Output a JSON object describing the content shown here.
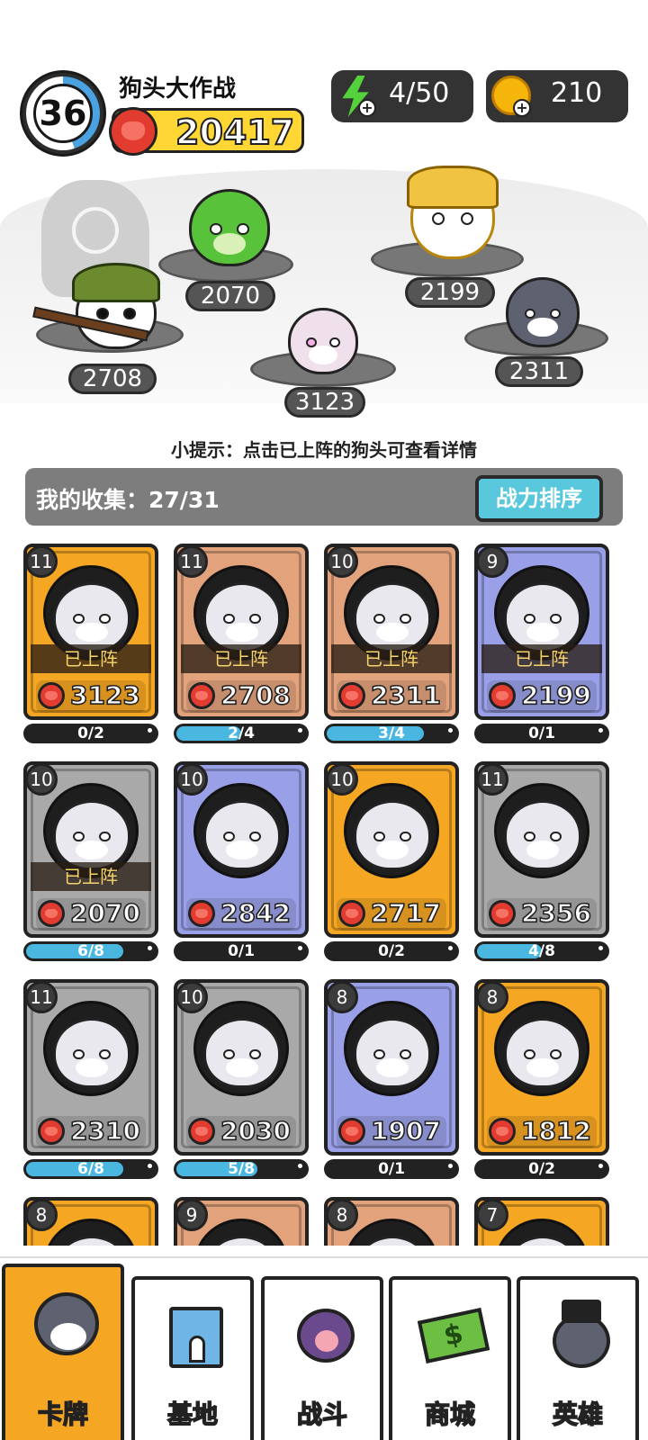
{
  "header": {
    "level": "36",
    "player_name": "狗头大作战",
    "total_power": "20417",
    "energy": "4/50",
    "coins": "210"
  },
  "lineup": [
    {
      "name": "salad-dog",
      "power": "2070"
    },
    {
      "name": "armored-dog",
      "power": "2199"
    },
    {
      "name": "soldier-dog",
      "power": "2708"
    },
    {
      "name": "laser-eye-dog",
      "power": "3123"
    },
    {
      "name": "husky",
      "power": "2311"
    }
  ],
  "tip": "小提示：点击已上阵的狗头可查看详情",
  "collection": {
    "label": "我的收集：27/31",
    "sort_button": "战力排序"
  },
  "cards": [
    {
      "level": "11",
      "deployed": "已上阵",
      "power": "3123",
      "progress": "0/2",
      "fill": 0,
      "color": "#f5a623",
      "portrait": "laser-eye-dog"
    },
    {
      "level": "11",
      "deployed": "已上阵",
      "power": "2708",
      "progress": "2/4",
      "fill": 0.5,
      "color": "#e2a27c",
      "portrait": "soldier-dog"
    },
    {
      "level": "10",
      "deployed": "已上阵",
      "power": "2311",
      "progress": "3/4",
      "fill": 0.75,
      "color": "#e2a27c",
      "portrait": "husky"
    },
    {
      "level": "9",
      "deployed": "已上阵",
      "power": "2199",
      "progress": "0/1",
      "fill": 0,
      "color": "#9aa0e8",
      "portrait": "armored-dog"
    },
    {
      "level": "10",
      "deployed": "已上阵",
      "power": "2070",
      "progress": "6/8",
      "fill": 0.75,
      "color": "#a9a9a9",
      "portrait": "salad-dog"
    },
    {
      "level": "10",
      "deployed": "",
      "power": "2842",
      "progress": "0/1",
      "fill": 0,
      "color": "#9aa0e8",
      "portrait": "ninja-dog"
    },
    {
      "level": "10",
      "deployed": "",
      "power": "2717",
      "progress": "0/2",
      "fill": 0,
      "color": "#f5a623",
      "portrait": "masked-dog"
    },
    {
      "level": "11",
      "deployed": "",
      "power": "2356",
      "progress": "4/8",
      "fill": 0.5,
      "color": "#a9a9a9",
      "portrait": "laptop-dog"
    },
    {
      "level": "11",
      "deployed": "",
      "power": "2310",
      "progress": "6/8",
      "fill": 0.75,
      "color": "#a9a9a9",
      "portrait": "grumpy-dog"
    },
    {
      "level": "10",
      "deployed": "",
      "power": "2030",
      "progress": "5/8",
      "fill": 0.625,
      "color": "#a9a9a9",
      "portrait": "eyebrow-dog"
    },
    {
      "level": "8",
      "deployed": "",
      "power": "1907",
      "progress": "0/1",
      "fill": 0,
      "color": "#9aa0e8",
      "portrait": "crown-dog"
    },
    {
      "level": "8",
      "deployed": "",
      "power": "1812",
      "progress": "0/2",
      "fill": 0,
      "color": "#f5a623",
      "portrait": "pikachu-dog"
    },
    {
      "level": "8",
      "deployed": "",
      "power": "",
      "progress": "",
      "fill": 0,
      "color": "#f5a623",
      "portrait": "green-dog"
    },
    {
      "level": "9",
      "deployed": "",
      "power": "",
      "progress": "",
      "fill": 0,
      "color": "#e2a27c",
      "portrait": "gray-dog"
    },
    {
      "level": "8",
      "deployed": "",
      "power": "",
      "progress": "",
      "fill": 0,
      "color": "#e2a27c",
      "portrait": "yellow-dog"
    },
    {
      "level": "7",
      "deployed": "",
      "power": "",
      "progress": "",
      "fill": 0,
      "color": "#f5a623",
      "portrait": "brown-dog"
    }
  ],
  "nav": [
    {
      "label": "卡牌",
      "icon": "husky-icon",
      "active": true
    },
    {
      "label": "基地",
      "icon": "castle-icon",
      "active": false
    },
    {
      "label": "战斗",
      "icon": "paw-icon",
      "active": false
    },
    {
      "label": "商城",
      "icon": "money-icon",
      "active": false
    },
    {
      "label": "英雄",
      "icon": "hero-dog-icon",
      "active": false
    }
  ],
  "colors": {
    "accent": "#5ac8dc",
    "power_bar": "#ffd633",
    "progress": "#4ab7e0",
    "active_tab": "#f5a623"
  }
}
